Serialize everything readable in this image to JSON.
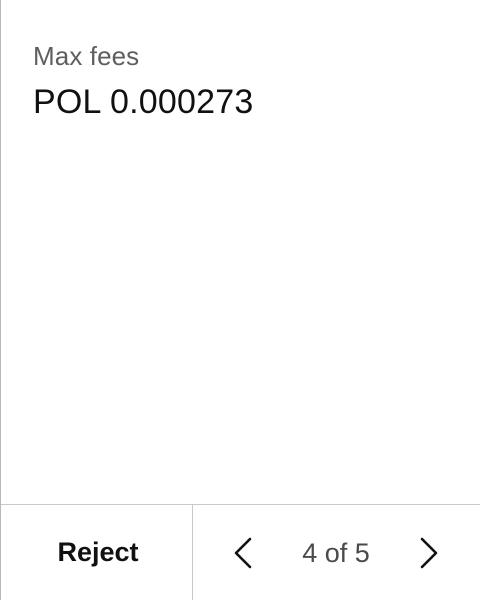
{
  "fees": {
    "label": "Max fees",
    "value": "POL 0.000273"
  },
  "footer": {
    "reject_label": "Reject",
    "pager": {
      "current": 4,
      "total": 5,
      "text": "4 of 5",
      "prev_icon": "chevron-left-icon",
      "next_icon": "chevron-right-icon"
    }
  },
  "colors": {
    "label_gray": "#5f5f5f",
    "text_dark": "#111111",
    "divider": "#c9c9c9"
  }
}
